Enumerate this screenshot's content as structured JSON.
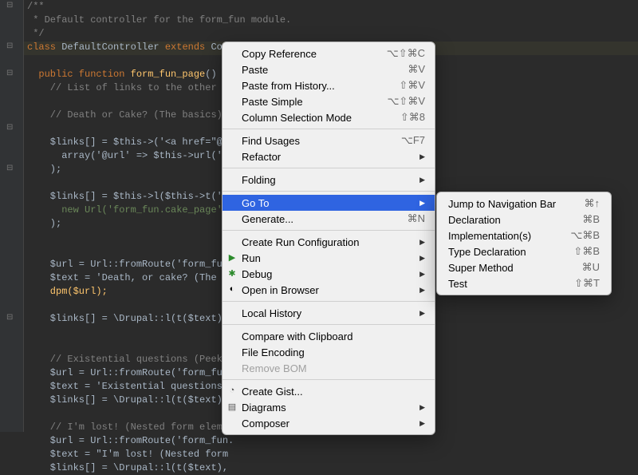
{
  "code": {
    "l1": "/**",
    "l2": " * Default controller for the form_fun module.",
    "l3": " */",
    "l4a": "class",
    "l4b": " DefaultController ",
    "l4c": "extends",
    "l4d": " Cont",
    "l5": "",
    "l6a": "  public function",
    "l6b": " form_fun_page",
    "l6c": "() {",
    "l7": "    // List of links to the other fo",
    "l8": "",
    "l9": "    // Death or Cake? (The basics)",
    "l10": "",
    "l11a": "    $links[] = $this->('<a href=\"@u",
    "l11b": "      array('@url' => $this->url('fo",
    "l11c": "    );",
    "l12": "",
    "l13a": "    $links[] = $this->l($this->t('De",
    "l13b": "      new Url('form_fun.cake_page')",
    "l13c": "    );",
    "l14": "",
    "l15": "",
    "l16a": "    $url = Url::fromRoute('form_fun.",
    "l16b": "    $text = 'Death, or cake? (The ba",
    "l16c": "    dpm($url);",
    "l17": "",
    "l18": "    $links[] = \\Drupal::l(t($text),",
    "l19": "",
    "l20": "",
    "l21": "    // Existential questions (Peekin",
    "l22": "    $url = Url::fromRoute('form_fun.",
    "l23": "    $text = 'Existential questions (",
    "l24": "    $links[] = \\Drupal::l(t($text),",
    "l25": "",
    "l26": "    // I'm lost! (Nested form elemen",
    "l27": "    $url = Url::fromRoute('form_fun.",
    "l28": "    $text = \"I'm lost! (Nested form ",
    "l29": "    $links[] = \\Drupal::l(t($text),"
  },
  "menu": {
    "copy_reference": {
      "label": "Copy Reference",
      "shortcut": "⌥⇧⌘C"
    },
    "paste": {
      "label": "Paste",
      "shortcut": "⌘V"
    },
    "paste_history": {
      "label": "Paste from History...",
      "shortcut": "⇧⌘V"
    },
    "paste_simple": {
      "label": "Paste Simple",
      "shortcut": "⌥⇧⌘V"
    },
    "column_sel": {
      "label": "Column Selection Mode",
      "shortcut": "⇧⌘8"
    },
    "find_usages": {
      "label": "Find Usages",
      "shortcut": "⌥F7"
    },
    "refactor": {
      "label": "Refactor"
    },
    "folding": {
      "label": "Folding"
    },
    "goto": {
      "label": "Go To"
    },
    "generate": {
      "label": "Generate...",
      "shortcut": "⌘N"
    },
    "create_run": {
      "label": "Create Run Configuration"
    },
    "run": {
      "label": "Run"
    },
    "debug": {
      "label": "Debug"
    },
    "open_browser": {
      "label": "Open in Browser"
    },
    "local_history": {
      "label": "Local History"
    },
    "compare_clip": {
      "label": "Compare with Clipboard"
    },
    "file_encoding": {
      "label": "File Encoding"
    },
    "remove_bom": {
      "label": "Remove BOM"
    },
    "create_gist": {
      "label": "Create Gist..."
    },
    "diagrams": {
      "label": "Diagrams"
    },
    "composer": {
      "label": "Composer"
    }
  },
  "submenu": {
    "jump_nav": {
      "label": "Jump to Navigation Bar",
      "shortcut": "⌘↑"
    },
    "declaration": {
      "label": "Declaration",
      "shortcut": "⌘B"
    },
    "implementations": {
      "label": "Implementation(s)",
      "shortcut": "⌥⌘B"
    },
    "type_decl": {
      "label": "Type Declaration",
      "shortcut": "⇧⌘B"
    },
    "super_method": {
      "label": "Super Method",
      "shortcut": "⌘U"
    },
    "test": {
      "label": "Test",
      "shortcut": "⇧⌘T"
    }
  }
}
